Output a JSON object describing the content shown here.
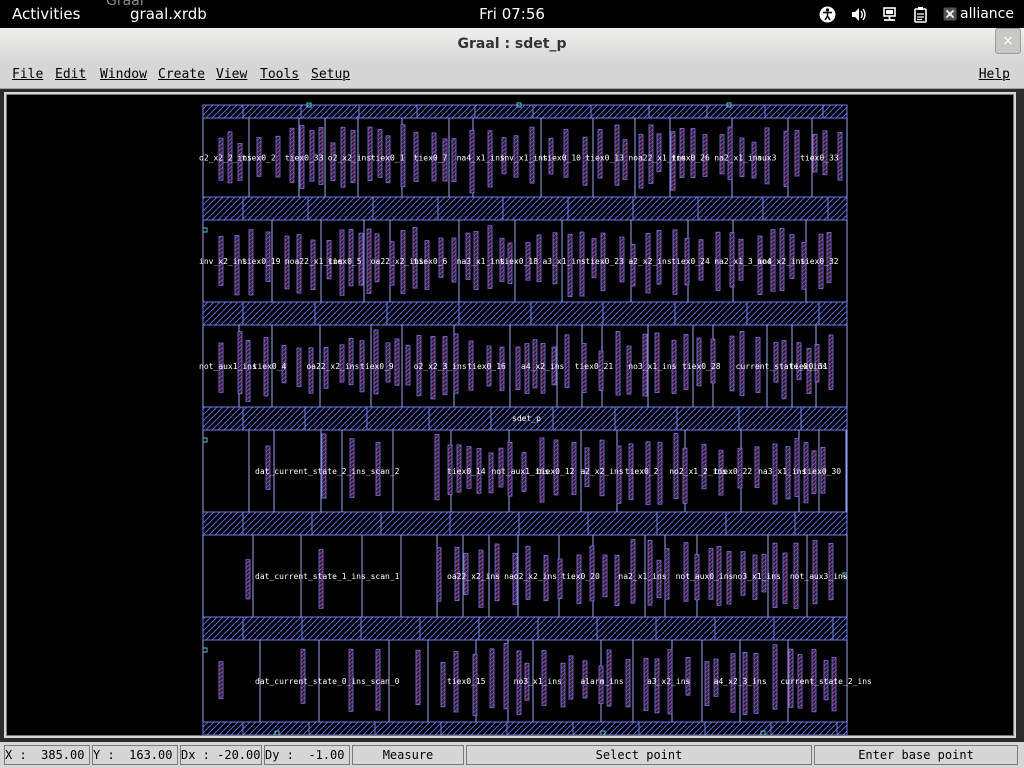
{
  "topbar": {
    "activities": "Activities",
    "app_name": "graal.xrdb",
    "ghost": "Graal",
    "clock": "Fri 07:56",
    "user": "alliance"
  },
  "window": {
    "title": "Graal : sdet_p",
    "close": "×"
  },
  "menu": {
    "file": "File",
    "edit": "Edit",
    "window": "Window",
    "create": "Create",
    "view": "View",
    "tools": "Tools",
    "setup": "Setup",
    "help": "Help"
  },
  "layout": {
    "rows": [
      {
        "labels": [
          "o2_x2_2_ins",
          "tiex0_2",
          "tiex0_33",
          "o2_x2_ins",
          "tiex0_1",
          "tiex0_7",
          "na4_x1_ins",
          "inv_x1_ins",
          "tiex0_10",
          "tiex0_13",
          "noa22_x1_ins",
          "tiex0_26",
          "na2_x1_ins",
          "aux3",
          "tiex0_33"
        ]
      },
      {
        "labels": [
          "inv_x2_ins",
          "tiex0_19",
          "noa22_x1_ins",
          "tiex0_5",
          "oa22_x2_ins",
          "tiex0_6",
          "na3_x1_ins",
          "tiex0_18",
          "a3_x1_ins",
          "tiex0_23",
          "a2_x2_ins",
          "tiex0_24",
          "na2_x1_3_ins",
          "no4_x2_ins",
          "tiex0_32"
        ]
      },
      {
        "labels": [
          "not_aux1_ins",
          "tiex0_4",
          "oa22_x2_ins",
          "tiex0_9",
          "o2_x2_3_ins",
          "tiex0_16",
          "a4_x2_ins",
          "tiex0_21",
          "no3_x1_ins",
          "tiex0_28",
          "current_state_0_ins",
          "tiex0_31"
        ]
      },
      {
        "labels": [
          "dat_current_state_2_ins_scan_2",
          "tiex0_14",
          "not_aux1_ins",
          "tiex0_12",
          "a2_x2_ins",
          "tiex0_2",
          "no2_x1_2_ins",
          "tiex0_22",
          "na3_x1_ins",
          "tiex0_30"
        ]
      },
      {
        "labels": [
          "dat_current_state_1_ins_scan_1",
          "oa22_x2_ins",
          "nao2_x2_ins",
          "tiex0_20",
          "na2_x1_ins",
          "not_aux0_ins",
          "no3_x1_ins",
          "not_aux3_ins"
        ]
      },
      {
        "labels": [
          "dat_current_state_0_ins_scan_0",
          "tiex0_15",
          "no3_x1_ins",
          "alarm_ins",
          "a3_x2_ins",
          "a4_x2_3_ins",
          "current_state_2_ins"
        ]
      }
    ],
    "cell_name": "sdet_p"
  },
  "status": {
    "x": "X :  385.00",
    "y": "Y :  163.00",
    "dx": "Dx : -20.00",
    "dy": "Dy :  -1.00",
    "mode": "Measure",
    "prompt": "Select point",
    "hint": "Enter base point"
  }
}
